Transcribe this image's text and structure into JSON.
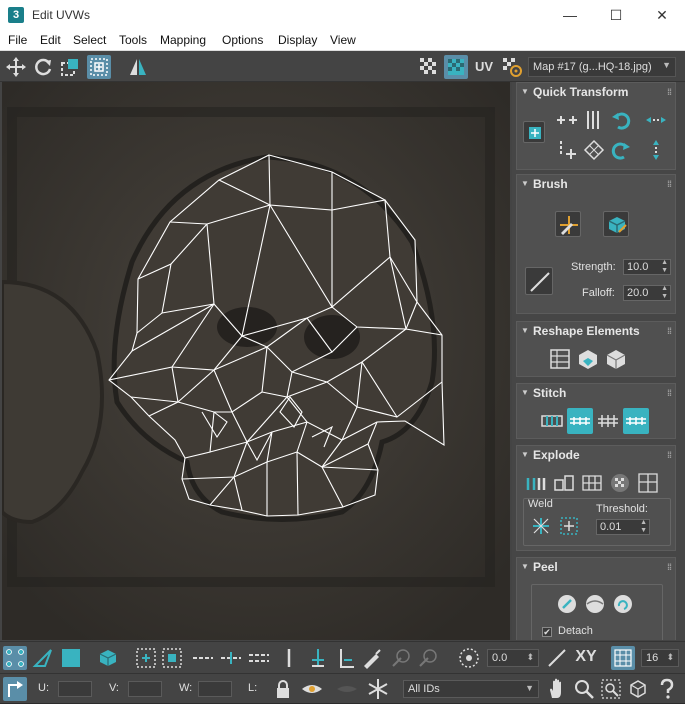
{
  "window": {
    "app_icon": "3",
    "title": "Edit UVWs",
    "minimize": "—",
    "maximize": "☐",
    "close": "✕"
  },
  "menu": [
    "File",
    "Edit",
    "Select",
    "Tools",
    "Mapping",
    "Options",
    "Display",
    "View"
  ],
  "toolbar_top": {
    "uv_label": "UV",
    "map_select": "Map #17 (g...HQ-18.jpg)"
  },
  "panel": {
    "quick_transform": {
      "title": "Quick Transform"
    },
    "brush": {
      "title": "Brush",
      "strength_label": "Strength:",
      "strength_value": "10.0",
      "falloff_label": "Falloff:",
      "falloff_value": "20.0"
    },
    "reshape": {
      "title": "Reshape Elements"
    },
    "stitch": {
      "title": "Stitch"
    },
    "explode": {
      "title": "Explode",
      "weld_label": "Weld",
      "threshold_label": "Threshold:",
      "threshold_value": "0.01"
    },
    "peel": {
      "title": "Peel",
      "detach_label": "Detach",
      "detach_checked": true
    }
  },
  "toolbar_bottom_1": {
    "angle_value": "0.0",
    "xy_label": "XY",
    "grid_value": "16"
  },
  "toolbar_bottom_2": {
    "u_label": "U:",
    "v_label": "V:",
    "w_label": "W:",
    "l_label": "L:",
    "ids_select": "All IDs"
  },
  "colors": {
    "accent": "#39b3c0",
    "active_toggle": "#5a8ea8",
    "panel_bg": "#464646"
  }
}
